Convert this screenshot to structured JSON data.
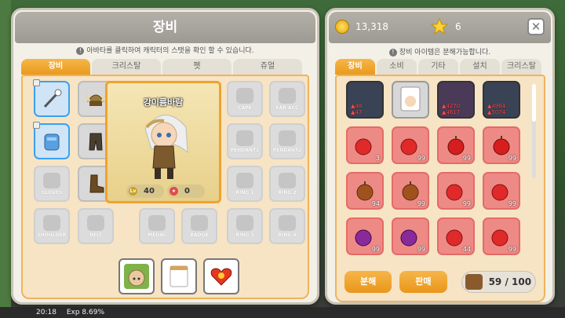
{
  "equipment": {
    "title": "장비",
    "notice": "아바타를 클릭하여 캐릭터의 스탯을 확인 할 수 있습니다.",
    "tabs": [
      {
        "label": "장비",
        "active": true
      },
      {
        "label": "크리스탈",
        "active": false
      },
      {
        "label": "펫",
        "active": false
      },
      {
        "label": "쥬얼",
        "active": false
      }
    ],
    "slots": {
      "gloves": "GLOVES",
      "shoulder": "SHOULDER",
      "belt": "BELT",
      "medal": "MEDAL",
      "badge": "BADGE",
      "cape": "CAPE",
      "earacc": "EAR ACC",
      "pendant1": "PENDANT1",
      "pendant2": "PENDANT2",
      "ring1": "RING 1",
      "ring2": "RING 2",
      "ring3": "RING 3",
      "ring4": "RING 4"
    },
    "character": {
      "name": "강이름바람",
      "level": "40",
      "popularity": "0"
    }
  },
  "inventory": {
    "meso": "13,318",
    "stars": "6",
    "notice": "장비 아이템은 분해가능합니다.",
    "tabs": [
      {
        "label": "장비",
        "active": true
      },
      {
        "label": "소비",
        "active": false
      },
      {
        "label": "기타",
        "active": false
      },
      {
        "label": "설치",
        "active": false
      },
      {
        "label": "크리스탈",
        "active": false
      }
    ],
    "equip_row_texts": {
      "item1": "▲48\n▲47",
      "item3": "▲4270\n▲4617",
      "item4": "▲4984\n▲5074"
    },
    "quantities": {
      "r2c1": "3",
      "r2c2": "99",
      "r2c3": "99",
      "r2c4": "99",
      "r3c1": "94",
      "r3c2": "99",
      "r3c3": "99",
      "r3c4": "99",
      "r4c1": "99",
      "r4c2": "99",
      "r4c3": "44",
      "r4c4": "99"
    },
    "disassemble_label": "분해",
    "sell_label": "판매",
    "capacity": "59 / 100"
  },
  "hud": {
    "time": "20:18",
    "exp": "Exp 8.69%"
  },
  "colors": {
    "accent": "#f0a22f",
    "tab_active": "#ea9a1c"
  }
}
